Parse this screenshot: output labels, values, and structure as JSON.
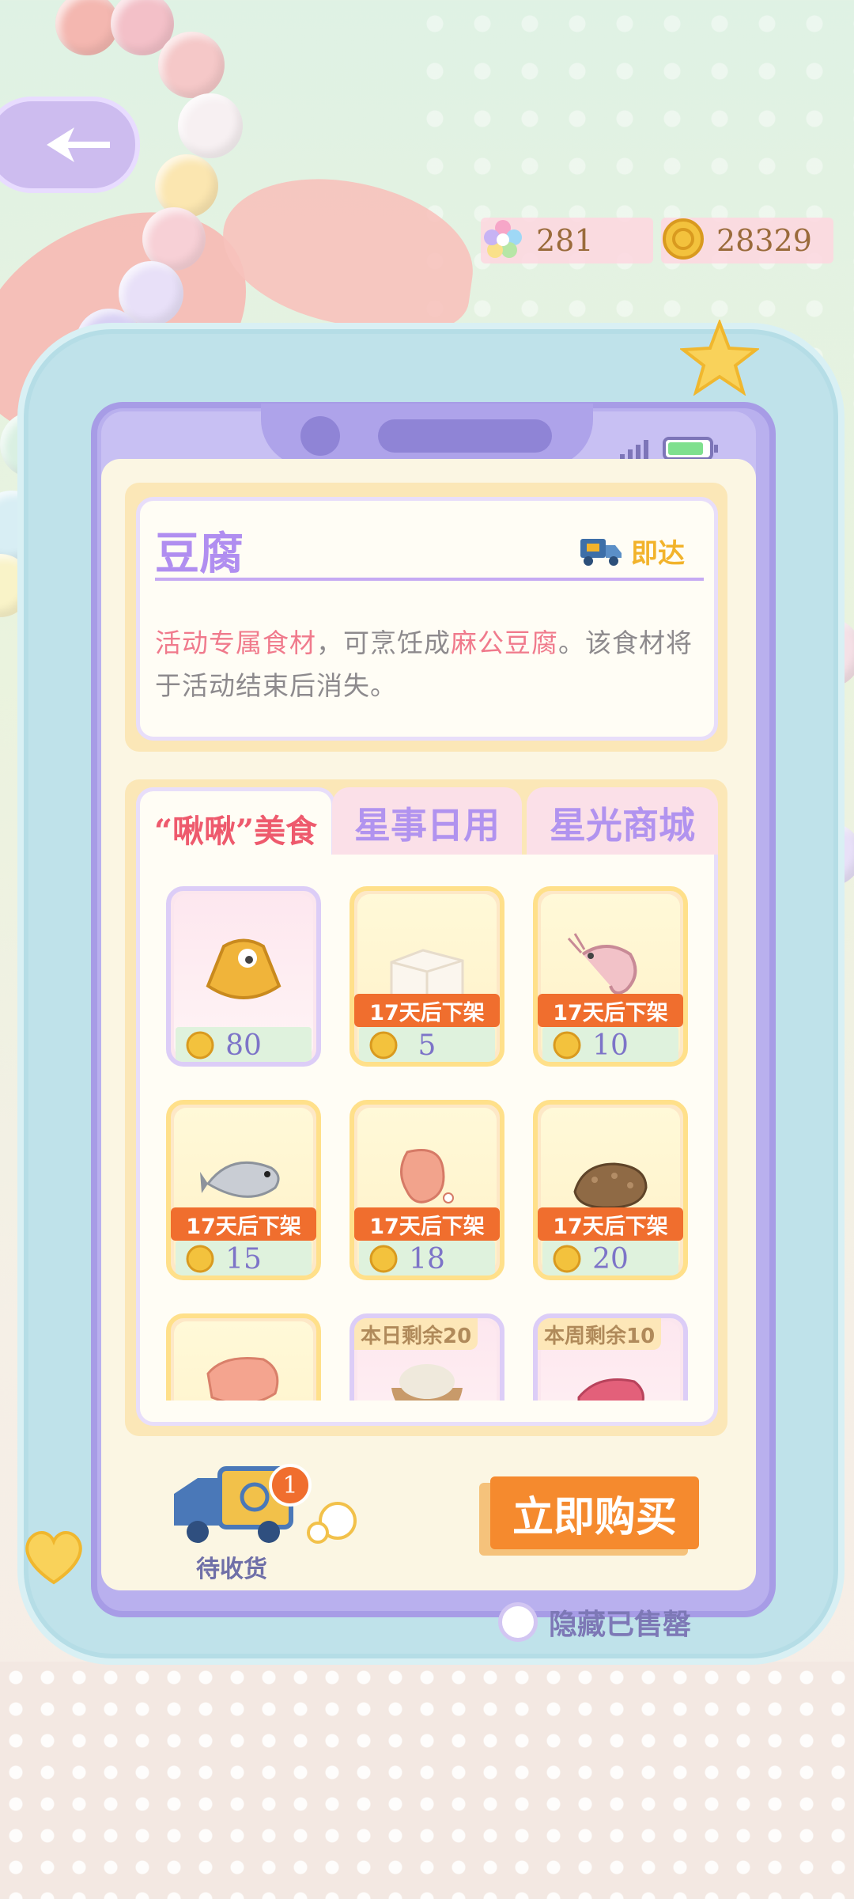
{
  "currencies": {
    "gems": "281",
    "coins": "28329"
  },
  "item": {
    "name": "豆腐",
    "delivery": "即达",
    "desc_part1": "活动专属食材",
    "desc_part2": "，可烹饪成",
    "desc_part3": "麻公豆腐",
    "desc_part4": "。该食材将于活动结束后消失。"
  },
  "tabs": [
    "“啾啾”美食",
    "星事日用",
    "星光商城"
  ],
  "products": [
    {
      "food": "ingredient-bag",
      "timer": "",
      "price": "80"
    },
    {
      "food": "tofu",
      "timer": "17天后下架",
      "price": "5"
    },
    {
      "food": "shrimp",
      "timer": "17天后下架",
      "price": "10"
    },
    {
      "food": "fish",
      "timer": "17天后下架",
      "price": "15"
    },
    {
      "food": "meat",
      "timer": "17天后下架",
      "price": "18"
    },
    {
      "food": "sea-cucumber",
      "timer": "17天后下架",
      "price": "20"
    },
    {
      "food": "pork",
      "limit": ""
    },
    {
      "food": "rice",
      "limit": "本日剩余20"
    },
    {
      "food": "beef",
      "limit": "本周剩余10"
    }
  ],
  "bottom": {
    "pending_label": "待收货",
    "pending_count": "1",
    "buy_label": "立即购买",
    "hide_sold_label": "隐藏已售罄"
  }
}
